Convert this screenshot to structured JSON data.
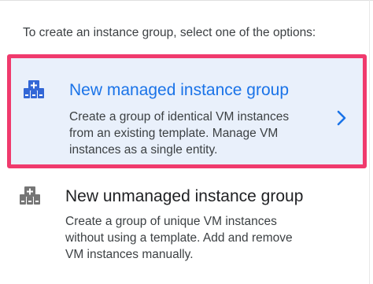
{
  "instructions": "To create an instance group, select one of the options:",
  "options": [
    {
      "title": "New managed instance group",
      "description": "Create a group of identical VM instances from an existing template. Manage VM instances as a single entity.",
      "icon": "instance-group-icon",
      "selected": true,
      "highlight_color": "#f03a6d",
      "title_color": "#1a73e8"
    },
    {
      "title": "New unmanaged instance group",
      "description": "Create a group of unique VM instances without using a template. Add and remove VM instances manually.",
      "icon": "instance-group-icon",
      "selected": false
    }
  ],
  "chevron_icon": "chevron-right-icon"
}
